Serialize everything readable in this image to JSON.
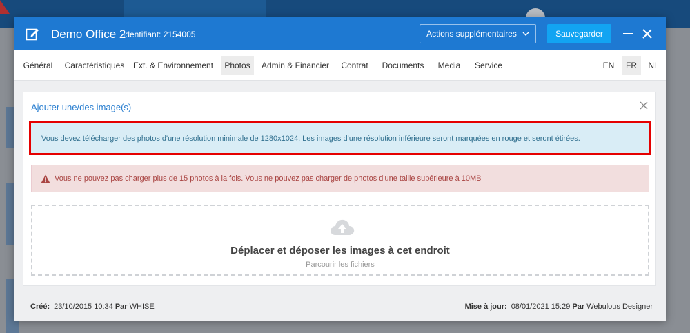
{
  "modal": {
    "title": "Demo Office 2",
    "identifier": "Identifiant: 2154005",
    "actions_label": "Actions supplémentaires",
    "save_label": "Sauvegarder"
  },
  "tabs": [
    {
      "label": "Général"
    },
    {
      "label": "Caractéristiques"
    },
    {
      "label": "Ext. & Environnement"
    },
    {
      "label": "Photos"
    },
    {
      "label": "Admin & Financier"
    },
    {
      "label": "Contrat"
    },
    {
      "label": "Documents"
    },
    {
      "label": "Media"
    },
    {
      "label": "Service"
    }
  ],
  "active_tab": "Photos",
  "languages": [
    {
      "label": "EN"
    },
    {
      "label": "FR"
    },
    {
      "label": "NL"
    }
  ],
  "active_language": "FR",
  "upload": {
    "title": "Ajouter une/des image(s)",
    "info_message": "Vous devez télécharger des photos d'une résolution minimale de 1280x1024. Les images d'une résolution inférieure seront marquées en rouge et seront étirées.",
    "warning_message": "Vous ne pouvez pas charger plus de 15 photos à la fois. Vous ne pouvez pas charger de photos d'une taille supérieure à 10MB",
    "drop_title": "Déplacer et déposer les images à cet endroit",
    "browse_label": "Parcourir les fichiers"
  },
  "footer": {
    "created_label": "Créé:",
    "created_date": "23/10/2015 10:34",
    "created_by_label": "Par",
    "created_by": "WHISE",
    "updated_label": "Mise à jour:",
    "updated_date": "08/01/2021 15:29",
    "updated_by_label": "Par",
    "updated_by": "Webulous Designer"
  },
  "colors": {
    "header_blue": "#1e79d2",
    "save_button": "#12a4f2",
    "info_bg": "#d9edf6",
    "highlight_border": "#e50000",
    "danger_bg": "#f2dede",
    "danger_text": "#a94442"
  }
}
